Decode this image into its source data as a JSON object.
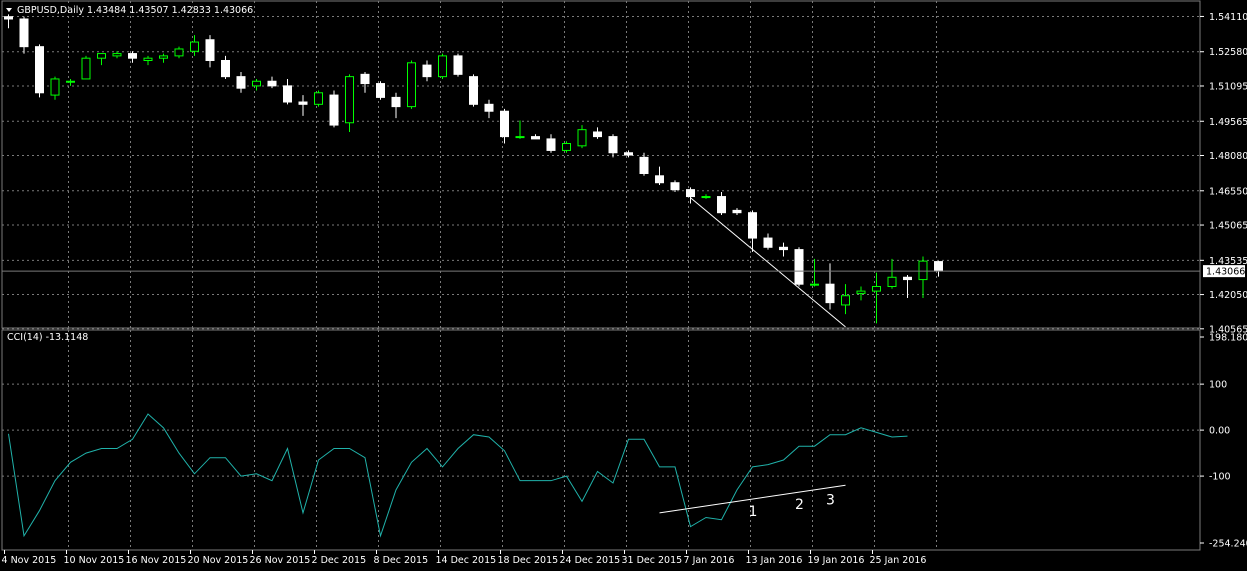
{
  "header": {
    "symbol_line": "GBPUSD,Daily  1.43484 1.43507 1.42833 1.43066"
  },
  "indicator": {
    "label": "CCI(14) -13.1148"
  },
  "colors": {
    "background": "#000000",
    "grid": "#7a7a7a",
    "bull_candle": "#00ff00",
    "bear_candle": "#ffffff",
    "cci_line": "#20b2aa",
    "trendline": "#ffffff"
  },
  "annotations": [
    "1",
    "2",
    "3"
  ],
  "chart_data": [
    {
      "type": "candlestick",
      "title": "GBPUSD,Daily",
      "price_axis_ticks": [
        "1.54110",
        "1.52580",
        "1.51095",
        "1.49565",
        "1.48080",
        "1.46550",
        "1.45065",
        "1.43535",
        "1.42050",
        "1.40565"
      ],
      "current_price_label": "1.43066",
      "current_price": 1.43066,
      "ylim": [
        1.406,
        1.5465
      ],
      "grid": true,
      "ohlc": [
        [
          1.541,
          1.542,
          1.536,
          1.54
        ],
        [
          1.54,
          1.541,
          1.525,
          1.528
        ],
        [
          1.528,
          1.529,
          1.506,
          1.508
        ],
        [
          1.507,
          1.515,
          1.505,
          1.514
        ],
        [
          1.513,
          1.514,
          1.511,
          1.513
        ],
        [
          1.514,
          1.524,
          1.514,
          1.523
        ],
        [
          1.523,
          1.525,
          1.52,
          1.525
        ],
        [
          1.524,
          1.526,
          1.523,
          1.525
        ],
        [
          1.525,
          1.526,
          1.521,
          1.523
        ],
        [
          1.522,
          1.524,
          1.52,
          1.523
        ],
        [
          1.523,
          1.525,
          1.521,
          1.524
        ],
        [
          1.524,
          1.528,
          1.523,
          1.527
        ],
        [
          1.526,
          1.533,
          1.524,
          1.53
        ],
        [
          1.531,
          1.533,
          1.519,
          1.522
        ],
        [
          1.522,
          1.524,
          1.514,
          1.515
        ],
        [
          1.515,
          1.517,
          1.508,
          1.51
        ],
        [
          1.511,
          1.514,
          1.509,
          1.513
        ],
        [
          1.513,
          1.515,
          1.51,
          1.511
        ],
        [
          1.511,
          1.514,
          1.503,
          1.504
        ],
        [
          1.504,
          1.507,
          1.498,
          1.503
        ],
        [
          1.503,
          1.509,
          1.502,
          1.508
        ],
        [
          1.507,
          1.509,
          1.493,
          1.494
        ],
        [
          1.495,
          1.516,
          1.491,
          1.515
        ],
        [
          1.516,
          1.517,
          1.508,
          1.512
        ],
        [
          1.512,
          1.513,
          1.505,
          1.506
        ],
        [
          1.506,
          1.508,
          1.497,
          1.502
        ],
        [
          1.502,
          1.522,
          1.501,
          1.521
        ],
        [
          1.52,
          1.522,
          1.513,
          1.515
        ],
        [
          1.515,
          1.525,
          1.514,
          1.524
        ],
        [
          1.524,
          1.525,
          1.515,
          1.516
        ],
        [
          1.515,
          1.516,
          1.502,
          1.503
        ],
        [
          1.503,
          1.505,
          1.497,
          1.5
        ],
        [
          1.5,
          1.501,
          1.486,
          1.489
        ],
        [
          1.489,
          1.496,
          1.488,
          1.489
        ],
        [
          1.489,
          1.49,
          1.488,
          1.488
        ],
        [
          1.488,
          1.49,
          1.482,
          1.483
        ],
        [
          1.483,
          1.487,
          1.482,
          1.486
        ],
        [
          1.485,
          1.494,
          1.484,
          1.492
        ],
        [
          1.491,
          1.493,
          1.488,
          1.489
        ],
        [
          1.489,
          1.49,
          1.48,
          1.482
        ],
        [
          1.482,
          1.483,
          1.48,
          1.481
        ],
        [
          1.48,
          1.482,
          1.472,
          1.473
        ],
        [
          1.472,
          1.476,
          1.468,
          1.469
        ],
        [
          1.469,
          1.47,
          1.465,
          1.466
        ],
        [
          1.466,
          1.467,
          1.46,
          1.463
        ],
        [
          1.463,
          1.464,
          1.462,
          1.463
        ],
        [
          1.463,
          1.465,
          1.455,
          1.456
        ],
        [
          1.457,
          1.458,
          1.455,
          1.456
        ],
        [
          1.456,
          1.457,
          1.439,
          1.445
        ],
        [
          1.445,
          1.447,
          1.44,
          1.441
        ],
        [
          1.441,
          1.443,
          1.437,
          1.44
        ],
        [
          1.44,
          1.441,
          1.424,
          1.425
        ],
        [
          1.425,
          1.436,
          1.424,
          1.425
        ],
        [
          1.425,
          1.434,
          1.414,
          1.417
        ],
        [
          1.416,
          1.425,
          1.412,
          1.42
        ],
        [
          1.421,
          1.424,
          1.418,
          1.422
        ],
        [
          1.422,
          1.43,
          1.408,
          1.424
        ],
        [
          1.424,
          1.436,
          1.423,
          1.428
        ],
        [
          1.428,
          1.429,
          1.419,
          1.427
        ],
        [
          1.427,
          1.437,
          1.419,
          1.435
        ],
        [
          1.4348,
          1.4351,
          1.4283,
          1.4307
        ]
      ],
      "x_tick_labels": [
        {
          "index": 0,
          "label": "4 Nov 2015"
        },
        {
          "index": 4,
          "label": "10 Nov 2015"
        },
        {
          "index": 8,
          "label": "16 Nov 2015"
        },
        {
          "index": 12,
          "label": "20 Nov 2015"
        },
        {
          "index": 16,
          "label": "26 Nov 2015"
        },
        {
          "index": 20,
          "label": "2 Dec 2015"
        },
        {
          "index": 24,
          "label": "8 Dec 2015"
        },
        {
          "index": 28,
          "label": "14 Dec 2015"
        },
        {
          "index": 32,
          "label": "18 Dec 2015"
        },
        {
          "index": 36,
          "label": "24 Dec 2015"
        },
        {
          "index": 40,
          "label": "31 Dec 2015"
        },
        {
          "index": 44,
          "label": "7 Jan 2016"
        },
        {
          "index": 48,
          "label": "13 Jan 2016"
        },
        {
          "index": 52,
          "label": "19 Jan 2016"
        },
        {
          "index": 56,
          "label": "25 Jan 2016"
        }
      ],
      "trendline": {
        "from": {
          "index": 44,
          "price": 1.4625
        },
        "to": {
          "index": 54,
          "price": 1.4065
        }
      }
    },
    {
      "type": "line",
      "title": "CCI(14)",
      "last_value": -13.1148,
      "axis_ticks": [
        "198.1801",
        "100",
        "0.00",
        "-100",
        "-254.2406"
      ],
      "ylim": [
        -254.2406,
        198.1801
      ],
      "grid": true,
      "values": [
        -8,
        -230,
        -175,
        -110,
        -70,
        -50,
        -40,
        -40,
        -20,
        35,
        5,
        -50,
        -95,
        -60,
        -60,
        -100,
        -95,
        -110,
        -40,
        -180,
        -65,
        -40,
        -40,
        -60,
        -230,
        -130,
        -70,
        -40,
        -80,
        -40,
        -10,
        -15,
        -45,
        -110,
        -110,
        -110,
        -100,
        -155,
        -90,
        -115,
        -20,
        -20,
        -80,
        -80,
        -210,
        -190,
        -195,
        -130,
        -80,
        -75,
        -65,
        -35,
        -35,
        -10,
        -10,
        5,
        -5,
        -15,
        -13
      ],
      "trendline": {
        "from": {
          "index": 42,
          "value": -180
        },
        "to": {
          "index": 54,
          "value": -120
        }
      }
    }
  ]
}
